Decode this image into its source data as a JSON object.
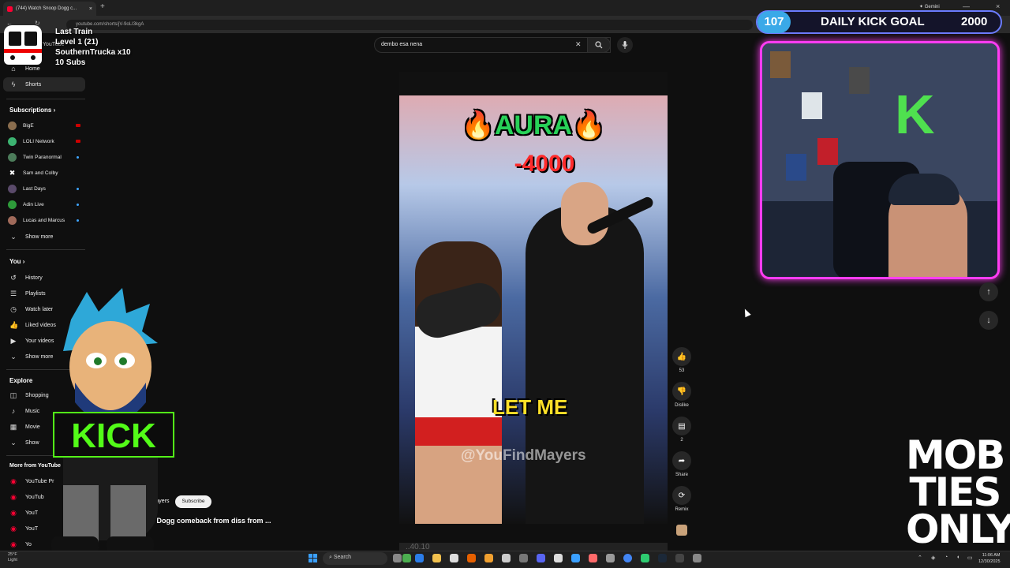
{
  "browser": {
    "tab_title": "(744) Watch Snoop Dogg c...",
    "url": "youtube.com/shorts/jV-9oLI3kgA",
    "gemini_label": "Gemini",
    "new_tab": "+"
  },
  "stream_overlay": {
    "train_line1": "Last Train",
    "train_line2": "Level 1  (21)",
    "train_line3": "SouthernTrucka x10",
    "train_line4": "10 Subs",
    "kick_goal": {
      "count": "107",
      "label": "DAILY KICK GOAL",
      "target": "2000"
    },
    "mob_text": "MOB TIES ONLY",
    "mascot_sign": "KICK",
    "colors": {
      "kick_green": "#53fc18",
      "cam_border": "#ff3cf2",
      "goal_badge": "#3aa9e8"
    }
  },
  "youtube": {
    "logo_text": "YouTube",
    "search": {
      "value": "dembo esa nena",
      "clear_icon": "close-icon",
      "search_icon": "search-icon",
      "mic_icon": "mic-icon"
    },
    "sidebar": {
      "home": "Home",
      "shorts": "Shorts",
      "subscriptions_header": "Subscriptions",
      "subscriptions": [
        {
          "name": "BigE",
          "indicator": "live"
        },
        {
          "name": "LOLI Network",
          "indicator": "live"
        },
        {
          "name": "Twin Paranormal",
          "indicator": "new"
        },
        {
          "name": "Sam and Colby",
          "indicator": ""
        },
        {
          "name": "Last Days",
          "indicator": "new"
        },
        {
          "name": "Adin Live",
          "indicator": "new"
        },
        {
          "name": "Lucas and Marcus",
          "indicator": "new"
        }
      ],
      "show_more_1": "Show more",
      "you_header": "You",
      "you_items": [
        "History",
        "Playlists",
        "Watch later",
        "Liked videos",
        "Your videos"
      ],
      "show_more_2": "Show more",
      "explore_header": "Explore",
      "explore_items": [
        "Shopping",
        "Music",
        "Movie",
        "Show"
      ],
      "more_header": "More from YouTube",
      "more_items": [
        "YouTube Pr",
        "YouTub",
        "YouT",
        "YouT",
        "Yo"
      ]
    },
    "video": {
      "aura_text": "🔥AURA🔥",
      "minus_text": "-4000",
      "caption": "LET ME",
      "watermark": "@YouFindMayers",
      "next_peek": "..40.10",
      "channel": "youfindmayers",
      "subscribe": "Subscribe",
      "title": "Snoop Dogg comeback from diss from ..."
    },
    "actions": {
      "like_count": "53",
      "dislike": "Dislike",
      "comments_count": "2",
      "share": "Share",
      "remix": "Remix"
    }
  },
  "taskbar": {
    "weather": "25°F",
    "weather_sub": "Light",
    "search": "Search",
    "time": "11:06 AM",
    "date": "12/30/2025"
  }
}
